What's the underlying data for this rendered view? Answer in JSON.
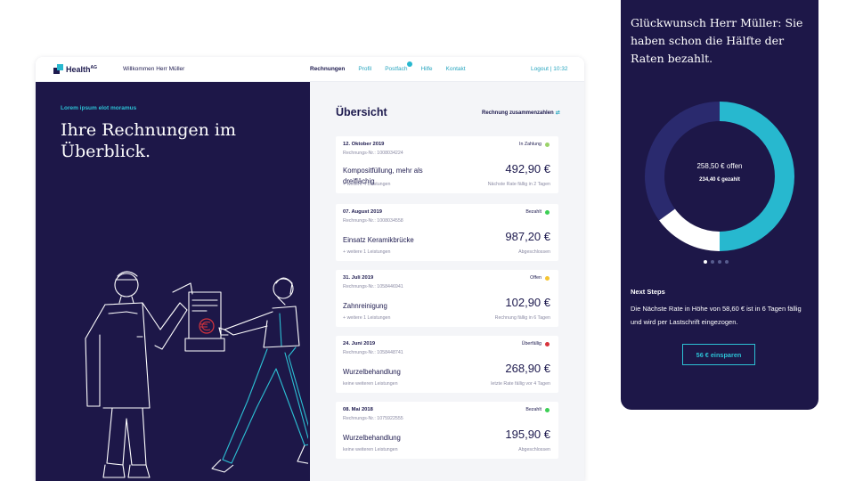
{
  "header": {
    "logo_text": "Health",
    "logo_sup": "AG",
    "welcome": "Willkommen Herr Müller",
    "nav": [
      {
        "label": "Rechnungen"
      },
      {
        "label": "Profil"
      },
      {
        "label": "Postfach"
      },
      {
        "label": "Hilfe"
      },
      {
        "label": "Kontakt"
      }
    ],
    "logout": "Logout",
    "time": "10:32"
  },
  "hero": {
    "kicker": "Lorem ipsum elot moramus",
    "title": "Ihre Rechnungen im Überblick."
  },
  "overview": {
    "title": "Übersicht",
    "summarize_link": "Rechnung zusammenzahlen",
    "invoices": [
      {
        "date": "12. Oktober 2019",
        "number": "Rechnungs-Nr.: 1008034224",
        "status": "In Zahlung",
        "status_color": "#9bd36a",
        "description": "Kompositfüllung, mehr als dreiflächig",
        "amount": "492,90 €",
        "more": "+ weitere 4 Leistungen",
        "note": "Nächste Rate fällig in 2 Tagen"
      },
      {
        "date": "07. August 2019",
        "number": "Rechnungs-Nr.: 1008034558",
        "status": "Bezahlt",
        "status_color": "#3ccf55",
        "description": "Einsatz Keramikbrücke",
        "amount": "987,20 €",
        "more": "+ weitere 1 Leistungen",
        "note": "Abgeschlossen"
      },
      {
        "date": "31. Juli 2019",
        "number": "Rechnungs-Nr.: 1058446941",
        "status": "Offen",
        "status_color": "#f5c431",
        "description": "Zahnreinigung",
        "amount": "102,90 €",
        "more": "+ weitere 1 Leistungen",
        "note": "Rechnung fällig in 6 Tagen"
      },
      {
        "date": "24. Juni 2019",
        "number": "Rechnungs-Nr.: 1058448741",
        "status": "Überfällig",
        "status_color": "#d8343c",
        "description": "Wurzelbehandlung",
        "amount": "268,90 €",
        "more": "keine weiteren Leistungen",
        "note": "letzte Rate fällig vor 4 Tagen"
      },
      {
        "date": "08. Mai 2018",
        "number": "Rechnungs-Nr.: 1075922555",
        "status": "Bezahlt",
        "status_color": "#3ccf55",
        "description": "Wurzelbehandlung",
        "amount": "195,90 €",
        "more": "keine weiteren Leistungen",
        "note": "Abgeschlossen"
      }
    ]
  },
  "mobile": {
    "headline": "Glückwunsch Herr Müller:  Sie haben schon die Hälfte der Raten bezahlt.",
    "donut": {
      "open_label": "258,50 € offen",
      "paid_label": "234,40 € gezahlt",
      "segments": [
        {
          "share": 0.5,
          "color": "#27b8cf"
        },
        {
          "share": 0.15,
          "color": "#ffffff"
        },
        {
          "share": 0.35,
          "color": "#2a2a6e"
        }
      ]
    },
    "pager_count": 4,
    "pager_active": 1,
    "next_steps_title": "Next Steps",
    "next_steps_body": "Die Nächste Rate in Höhe von 58,60 € ist in 6 Tagen fällig und wird per Lastschrift eingezogen.",
    "save_button": "56 € einsparen"
  }
}
